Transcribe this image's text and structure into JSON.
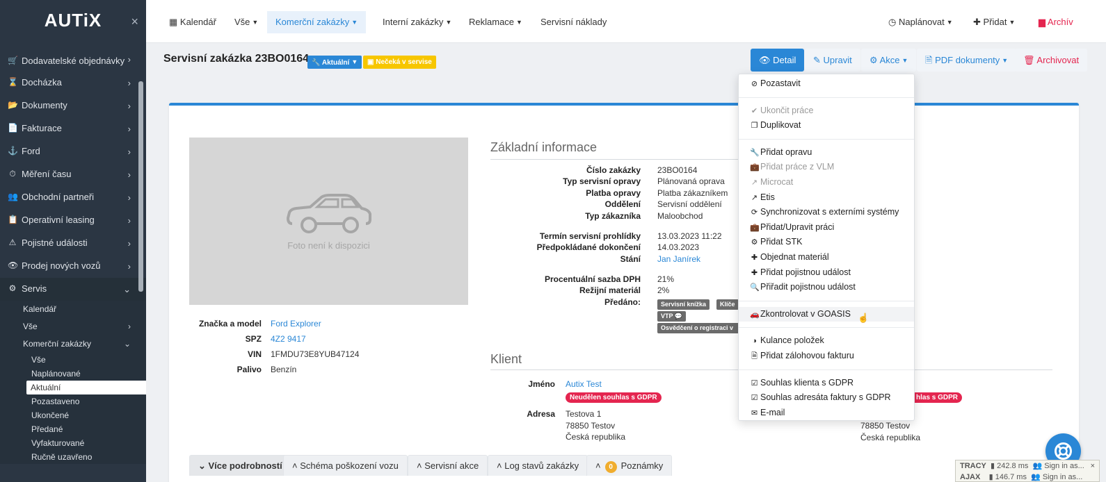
{
  "app": {
    "logo": "AUTiX",
    "close_icon": "×"
  },
  "sidebar": {
    "items": [
      {
        "label": "Dodavatelské objednávky",
        "icon": "🛒"
      },
      {
        "label": "Docházka",
        "icon": "⌛"
      },
      {
        "label": "Dokumenty",
        "icon": "📂"
      },
      {
        "label": "Fakturace",
        "icon": "📄"
      },
      {
        "label": "Ford",
        "icon": "⚓"
      },
      {
        "label": "Měření času",
        "icon": "⏱"
      },
      {
        "label": "Obchodní partneři",
        "icon": "👥"
      },
      {
        "label": "Operativní leasing",
        "icon": "📋"
      },
      {
        "label": "Pojistné události",
        "icon": "⚠"
      },
      {
        "label": "Prodej nových vozů",
        "icon": "👁"
      },
      {
        "label": "Servis",
        "icon": "⚙"
      }
    ],
    "servis_sub": [
      "Kalendář",
      "Vše",
      "Komerční zakázky"
    ],
    "komercni_sub": [
      "Vše",
      "Naplánované",
      "Aktuální",
      "Pozastaveno",
      "Ukončené",
      "Předané",
      "Vyfakturované",
      "Ručně uzavřeno"
    ]
  },
  "topnav": {
    "calendar": "Kalendář",
    "all": "Vše",
    "commercial": "Komerční zakázky",
    "internal": "Interní zakázky",
    "complaints": "Reklamace",
    "service_costs": "Servisní náklady",
    "plan": "Naplánovat",
    "add": "Přidat",
    "archive": "Archív"
  },
  "header": {
    "title": "Servisní zakázka 23BO0164",
    "badge_status": "Aktuální",
    "badge_waiting": "Nečeká v servise",
    "btn_detail": "Detail",
    "btn_edit": "Upravit",
    "btn_actions": "Akce",
    "btn_pdf": "PDF dokumenty",
    "btn_archive": "Archivovat"
  },
  "photo": {
    "caption": "Foto není k dispozici"
  },
  "vehicle": [
    {
      "k": "Značka a model",
      "v": "Ford Explorer",
      "link": true
    },
    {
      "k": "SPZ",
      "v": "4Z2 9417",
      "link": true
    },
    {
      "k": "VIN",
      "v": "1FMDU73E8YUB47124",
      "link": false
    },
    {
      "k": "Palivo",
      "v": "Benzín",
      "link": false
    }
  ],
  "basic": {
    "title": "Základní informace",
    "rows": [
      {
        "k": "Číslo zakázky",
        "v": "23BO0164"
      },
      {
        "k": "Typ servisní opravy",
        "v": "Plánovaná oprava"
      },
      {
        "k": "Platba opravy",
        "v": "Platba zákazníkem"
      },
      {
        "k": "Oddělení",
        "v": "Servisní oddělení"
      },
      {
        "k": "Typ zákazníka",
        "v": "Maloobchod"
      },
      {
        "k": "Termín servisní prohlídky",
        "v": "13.03.2023 11:22"
      },
      {
        "k": "Předpokládané dokončení",
        "v": "14.03.2023"
      },
      {
        "k": "Stání",
        "v": "Jan Janírek"
      },
      {
        "k": "Procentuální sazba DPH",
        "v": "21%"
      },
      {
        "k": "Režijní materiál",
        "v": "2%"
      },
      {
        "k": "Předáno:",
        "v": ""
      }
    ],
    "handed": [
      "Servisní knížka",
      "Klíče",
      "VTP 💬",
      "Osvědčení o registraci v"
    ]
  },
  "client": {
    "title": "Klient",
    "name_label": "Jméno",
    "name": "Autix Test",
    "gdpr": "Neudělen souhlas s GDPR",
    "gdpr2": "hlas s GDPR",
    "address_label": "Adresa",
    "addr1": "Testova 1",
    "addr2": "78850 Testov",
    "addr3": "Česká republika",
    "addr2b": "78850 Testov",
    "addr3b": "Česká republika"
  },
  "tabs": [
    "Více podrobností",
    "Schéma poškození vozu",
    "Servisní akce",
    "Log stavů zakázky",
    "Poznámky"
  ],
  "notes_count": "0",
  "menu": [
    {
      "label": "Pozastavit",
      "icon": "⊘",
      "dis": false
    },
    {
      "sep": true
    },
    {
      "label": "Ukončit práce",
      "icon": "✔",
      "dis": true
    },
    {
      "label": "Duplikovat",
      "icon": "❐",
      "dis": false
    },
    {
      "sep": true
    },
    {
      "label": "Přidat opravu",
      "icon": "🔧",
      "dis": false
    },
    {
      "label": "Přidat práce z VLM",
      "icon": "💼",
      "dis": true
    },
    {
      "label": "Microcat",
      "icon": "↗",
      "dis": true
    },
    {
      "label": "Etis",
      "icon": "↗",
      "dis": false
    },
    {
      "label": "Synchronizovat s externími systémy",
      "icon": "⟳",
      "dis": false
    },
    {
      "label": "Přidat/Upravit práci",
      "icon": "💼",
      "dis": false
    },
    {
      "label": "Přidat STK",
      "icon": "⚙",
      "dis": false
    },
    {
      "label": "Objednat materiál",
      "icon": "✚",
      "dis": false
    },
    {
      "label": "Přidat pojistnou událost",
      "icon": "✚",
      "dis": false
    },
    {
      "label": "Přiřadit pojistnou událost",
      "icon": "🔍",
      "dis": false
    },
    {
      "sep": true
    },
    {
      "label": "Zkontrolovat v GOASIS",
      "icon": "🚗",
      "dis": false,
      "hl": true
    },
    {
      "sep": true
    },
    {
      "label": "Kulance položek",
      "icon": "◑",
      "dis": false
    },
    {
      "label": "Přidat zálohovou fakturu",
      "icon": "🗎",
      "dis": false
    },
    {
      "sep": true
    },
    {
      "label": "Souhlas klienta s GDPR",
      "icon": "☑",
      "dis": false
    },
    {
      "label": "Souhlas adresáta faktury s GDPR",
      "icon": "☑",
      "dis": false
    },
    {
      "label": "E-mail",
      "icon": "✉",
      "dis": false
    }
  ],
  "tracy": {
    "r1_label": "TRACY",
    "r1_time": "242.8 ms",
    "r1_user": "Sign in as...",
    "r2_label": "AJAX",
    "r2_time": "146.7 ms",
    "r2_user": "Sign in as...",
    "close": "×"
  },
  "colors": {
    "primary": "#2a87d6",
    "danger": "#e4254f",
    "sidebar": "#2b3643",
    "warning": "#f7c600"
  }
}
